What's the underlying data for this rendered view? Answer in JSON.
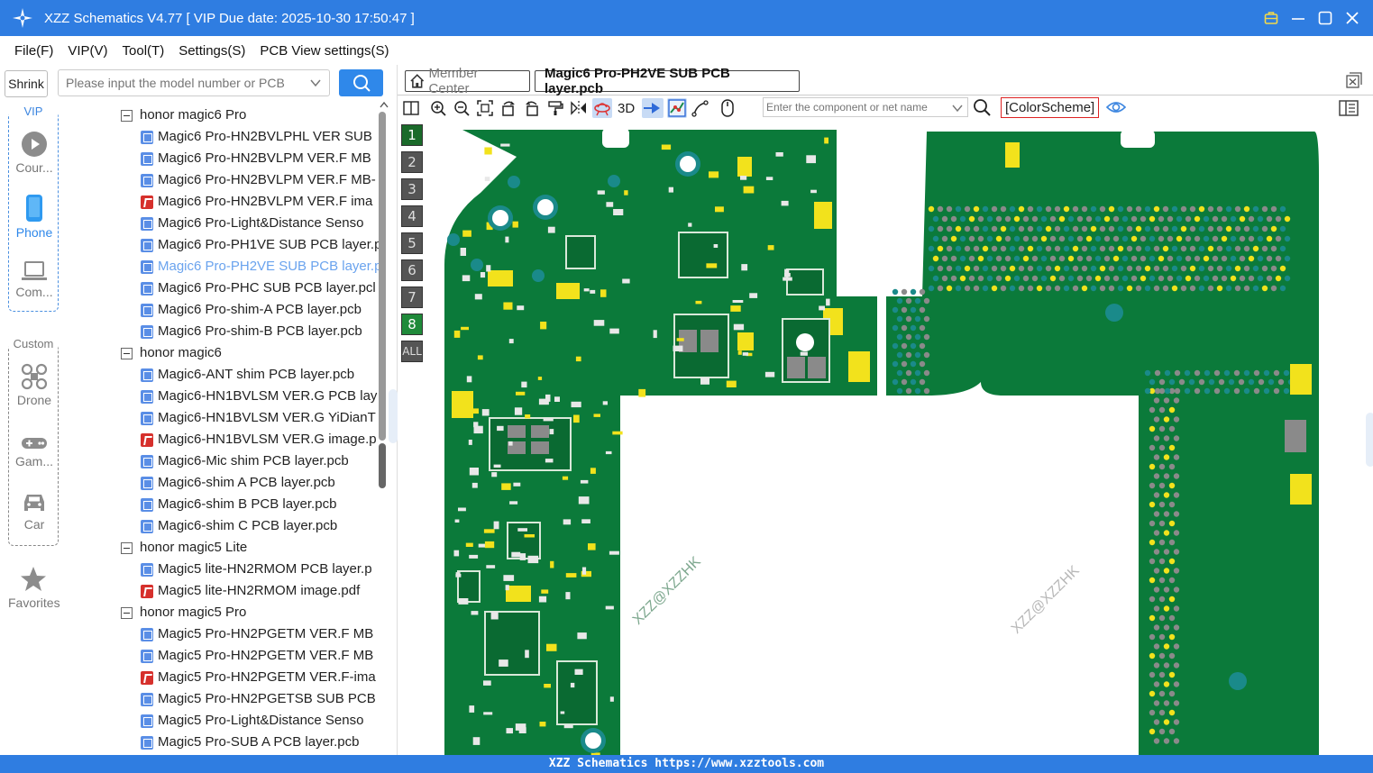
{
  "window": {
    "title": "XZZ Schematics V4.77 [ VIP Due date: 2025-10-30 17:50:47 ]"
  },
  "menu": [
    "File(F)",
    "VIP(V)",
    "Tool(T)",
    "Settings(S)",
    "PCB View settings(S)"
  ],
  "sidebar": {
    "shrink_label": "Shrink",
    "vip_group_title": "VIP",
    "custom_group_title": "Custom",
    "tools": [
      {
        "label": "Cour...",
        "icon": "play-icon"
      },
      {
        "label": "Phone",
        "icon": "phone-icon",
        "active": true
      },
      {
        "label": "Com...",
        "icon": "laptop-icon"
      },
      {
        "label": "Drone",
        "icon": "drone-icon"
      },
      {
        "label": "Gam...",
        "icon": "gamepad-icon"
      },
      {
        "label": "Car",
        "icon": "car-icon"
      },
      {
        "label": "Favorites",
        "icon": "star-icon"
      }
    ]
  },
  "search": {
    "placeholder": "Please input the model number or PCB"
  },
  "tree": [
    {
      "type": "group",
      "label": "honor magic6 Pro"
    },
    {
      "type": "pcb",
      "label": "Magic6 Pro-HN2BVLPHL VER SUB"
    },
    {
      "type": "pcb",
      "label": "Magic6 Pro-HN2BVLPM VER.F MB"
    },
    {
      "type": "pcb",
      "label": "Magic6 Pro-HN2BVLPM VER.F MB-"
    },
    {
      "type": "pdf",
      "label": "Magic6 Pro-HN2BVLPM VER.F ima"
    },
    {
      "type": "pcb",
      "label": "Magic6 Pro-Light&Distance Senso"
    },
    {
      "type": "pcb",
      "label": "Magic6 Pro-PH1VE SUB PCB layer.p"
    },
    {
      "type": "pcb",
      "label": "Magic6 Pro-PH2VE SUB PCB layer.p",
      "selected": true
    },
    {
      "type": "pcb",
      "label": "Magic6 Pro-PHC SUB PCB layer.pcl"
    },
    {
      "type": "pcb",
      "label": "Magic6 Pro-shim-A PCB layer.pcb"
    },
    {
      "type": "pcb",
      "label": "Magic6 Pro-shim-B PCB layer.pcb"
    },
    {
      "type": "group",
      "label": "honor magic6"
    },
    {
      "type": "pcb",
      "label": "Magic6-ANT shim PCB layer.pcb"
    },
    {
      "type": "pcb",
      "label": "Magic6-HN1BVLSM VER.G PCB lay"
    },
    {
      "type": "pcb",
      "label": "Magic6-HN1BVLSM VER.G YiDianT"
    },
    {
      "type": "pdf",
      "label": "Magic6-HN1BVLSM VER.G image.p"
    },
    {
      "type": "pcb",
      "label": "Magic6-Mic shim PCB layer.pcb"
    },
    {
      "type": "pcb",
      "label": "Magic6-shim A PCB layer.pcb"
    },
    {
      "type": "pcb",
      "label": "Magic6-shim B PCB layer.pcb"
    },
    {
      "type": "pcb",
      "label": "Magic6-shim C PCB layer.pcb"
    },
    {
      "type": "group",
      "label": "honor magic5 Lite"
    },
    {
      "type": "pcb",
      "label": "Magic5 lite-HN2RMOM PCB layer.p"
    },
    {
      "type": "pdf",
      "label": "Magic5 lite-HN2RMOM image.pdf"
    },
    {
      "type": "group",
      "label": "honor magic5 Pro"
    },
    {
      "type": "pcb",
      "label": "Magic5 Pro-HN2PGETM VER.F MB"
    },
    {
      "type": "pcb",
      "label": "Magic5 Pro-HN2PGETM VER.F MB"
    },
    {
      "type": "pdf",
      "label": "Magic5 Pro-HN2PGETM VER.F-ima"
    },
    {
      "type": "pcb",
      "label": "Magic5 Pro-HN2PGETSB SUB PCB"
    },
    {
      "type": "pcb",
      "label": "Magic5 Pro-Light&Distance Senso"
    },
    {
      "type": "pcb",
      "label": "Magic5 Pro-SUB A PCB layer.pcb"
    }
  ],
  "tabs": {
    "member_center": "Member Center",
    "active_tab": "Magic6 Pro-PH2VE SUB PCB layer.pcb"
  },
  "toolbar": {
    "three_d_label": "3D",
    "component_search_placeholder": "Enter the component or net name",
    "color_scheme_label": "[ColorScheme]"
  },
  "layers": [
    "1",
    "2",
    "3",
    "4",
    "5",
    "6",
    "7",
    "8",
    "ALL"
  ],
  "pcb": {
    "watermark": "XZZ@XZZHK",
    "board_color": "#0b7a3a",
    "pad_color": "#f2e21c",
    "via_color": "#1a8a8a"
  },
  "statusbar": {
    "text": "XZZ Schematics https://www.xzztools.com"
  },
  "colors": {
    "accent": "#2f7de1",
    "selected_item": "#6aa3ee"
  }
}
